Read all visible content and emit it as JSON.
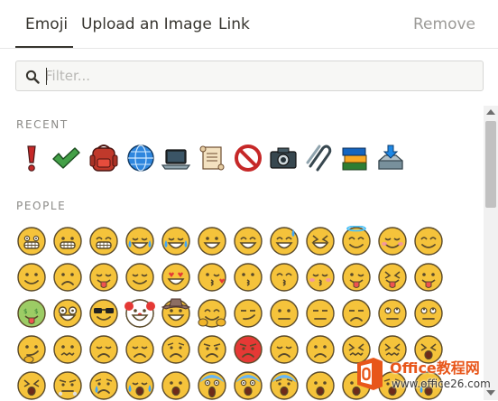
{
  "tabs": {
    "emoji": "Emoji",
    "upload": "Upload an Image",
    "link": "Link",
    "remove": "Remove"
  },
  "filter": {
    "placeholder": "Filter..."
  },
  "sections": {
    "recent": "RECENT",
    "people": "PEOPLE"
  },
  "recent_icons": [
    "exclamation-icon",
    "check-mark-icon",
    "backpack-icon",
    "globe-icon",
    "laptop-icon",
    "scroll-icon",
    "prohibited-icon",
    "camera-icon",
    "paperclips-icon",
    "books-icon",
    "inbox-tray-icon"
  ],
  "people_rows": [
    [
      "grimacing",
      "grinning",
      "grin",
      "joy",
      "rofl",
      "smiley",
      "smile",
      "sweat-smile",
      "laughing",
      "halo",
      "blush",
      "happy"
    ],
    [
      "slight-smile",
      "upside-down",
      "yum",
      "relieved",
      "heart-eyes",
      "kissing-heart",
      "kissing",
      "kissing-smiling",
      "kissing-closed",
      "wink-tongue",
      "squint-tongue",
      "tongue"
    ],
    [
      "money-mouth",
      "nerd",
      "sunglasses",
      "clown",
      "cowboy",
      "hugging",
      "smirk",
      "neutral",
      "expressionless",
      "unamused",
      "eye-roll",
      "thinking-alt"
    ],
    [
      "thinking",
      "confused",
      "pensive",
      "disappointed",
      "worried",
      "angry",
      "pouting",
      "sad",
      "frowning",
      "persevere",
      "confounded",
      "tired"
    ],
    [
      "weary",
      "triumph",
      "cry",
      "sob",
      "open-mouth",
      "scream",
      "fearful",
      "cold-sweat",
      "hushed",
      "frowning-open",
      "anguished",
      "sleepy"
    ]
  ],
  "watermark": {
    "title": "Office教程网",
    "url": "www.office26.com",
    "brand_color": "#e8561a"
  },
  "colors": {
    "face_fill": "#f5c33b",
    "face_outline": "#5a4a2a",
    "accent_red": "#d32f2f",
    "text": "#37352f",
    "muted": "#9b9a97"
  }
}
